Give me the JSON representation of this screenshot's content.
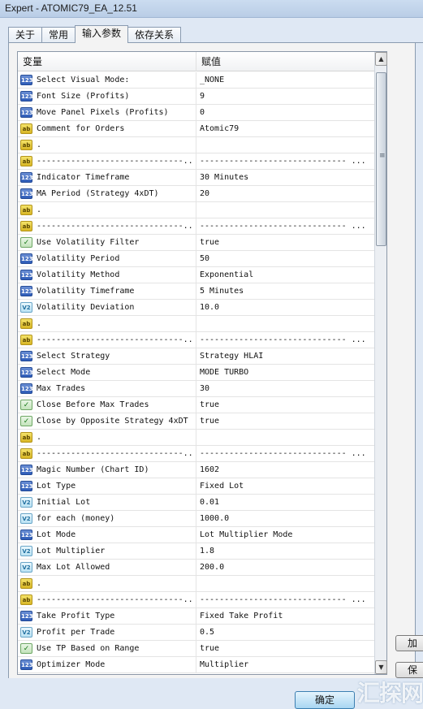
{
  "window": {
    "title": "Expert - ATOMIC79_EA_12.51"
  },
  "tabs": [
    {
      "label": "关于"
    },
    {
      "label": "常用"
    },
    {
      "label": "输入参数",
      "active": true
    },
    {
      "label": "依存关系"
    }
  ],
  "grid": {
    "col_variable": "变量",
    "col_value": "赋值",
    "rows": [
      {
        "type": "int",
        "name": "Select Visual Mode:",
        "value": "_NONE"
      },
      {
        "type": "int",
        "name": "Font Size (Profits)",
        "value": "9"
      },
      {
        "type": "int",
        "name": "Move Panel Pixels (Profits)",
        "value": "0"
      },
      {
        "type": "string",
        "name": "Comment for Orders",
        "value": "Atomic79"
      },
      {
        "type": "string",
        "name": ".",
        "value": ""
      },
      {
        "type": "string",
        "name": "------------------------------...",
        "value": "------------------------------ ..."
      },
      {
        "type": "int",
        "name": "Indicator Timeframe",
        "value": "30 Minutes"
      },
      {
        "type": "int",
        "name": "MA Period (Strategy 4xDT)",
        "value": "20"
      },
      {
        "type": "string",
        "name": ".",
        "value": ""
      },
      {
        "type": "string",
        "name": "------------------------------...",
        "value": "------------------------------ ..."
      },
      {
        "type": "bool",
        "name": "Use Volatility Filter",
        "value": "true"
      },
      {
        "type": "int",
        "name": "Volatility Period",
        "value": "50"
      },
      {
        "type": "int",
        "name": "Volatility Method",
        "value": "Exponential"
      },
      {
        "type": "int",
        "name": "Volatility Timeframe",
        "value": "5 Minutes"
      },
      {
        "type": "double",
        "name": "Volatility Deviation",
        "value": "10.0"
      },
      {
        "type": "string",
        "name": ".",
        "value": ""
      },
      {
        "type": "string",
        "name": "------------------------------...",
        "value": "------------------------------ ..."
      },
      {
        "type": "int",
        "name": "Select Strategy",
        "value": "Strategy HLAI"
      },
      {
        "type": "int",
        "name": "Select Mode",
        "value": "MODE TURBO"
      },
      {
        "type": "int",
        "name": "Max Trades",
        "value": "30"
      },
      {
        "type": "bool",
        "name": "Close Before Max Trades",
        "value": "true"
      },
      {
        "type": "bool",
        "name": "Close by Opposite Strategy 4xDT",
        "value": "true"
      },
      {
        "type": "string",
        "name": ".",
        "value": ""
      },
      {
        "type": "string",
        "name": "------------------------------...",
        "value": "------------------------------ ..."
      },
      {
        "type": "int",
        "name": "Magic Number (Chart ID)",
        "value": "1602"
      },
      {
        "type": "int",
        "name": "Lot Type",
        "value": "Fixed Lot"
      },
      {
        "type": "double",
        "name": "Initial Lot",
        "value": "0.01"
      },
      {
        "type": "double",
        "name": "for each (money)",
        "value": "1000.0"
      },
      {
        "type": "int",
        "name": "Lot Mode",
        "value": "Lot Multiplier Mode"
      },
      {
        "type": "double",
        "name": "Lot Multiplier",
        "value": "1.8"
      },
      {
        "type": "double",
        "name": "Max Lot Allowed",
        "value": "200.0"
      },
      {
        "type": "string",
        "name": ".",
        "value": ""
      },
      {
        "type": "string",
        "name": "------------------------------...",
        "value": "------------------------------ ..."
      },
      {
        "type": "int",
        "name": "Take Profit Type",
        "value": "Fixed Take Profit"
      },
      {
        "type": "double",
        "name": "Profit per Trade",
        "value": "0.5"
      },
      {
        "type": "bool",
        "name": "Use TP Based on Range",
        "value": "true"
      },
      {
        "type": "int",
        "name": "Optimizer Mode",
        "value": "Multiplier"
      }
    ]
  },
  "icons": {
    "int": {
      "glyph": "123",
      "name": "integer-type-icon"
    },
    "string": {
      "glyph": "ab",
      "name": "string-type-icon"
    },
    "bool": {
      "glyph": "✓",
      "name": "boolean-type-icon"
    },
    "double": {
      "glyph": "V2",
      "name": "double-type-icon"
    }
  },
  "side_buttons": [
    {
      "label": "加"
    },
    {
      "label": "保"
    }
  ],
  "ok_button": {
    "label": "确定"
  },
  "watermark": "汇探网"
}
